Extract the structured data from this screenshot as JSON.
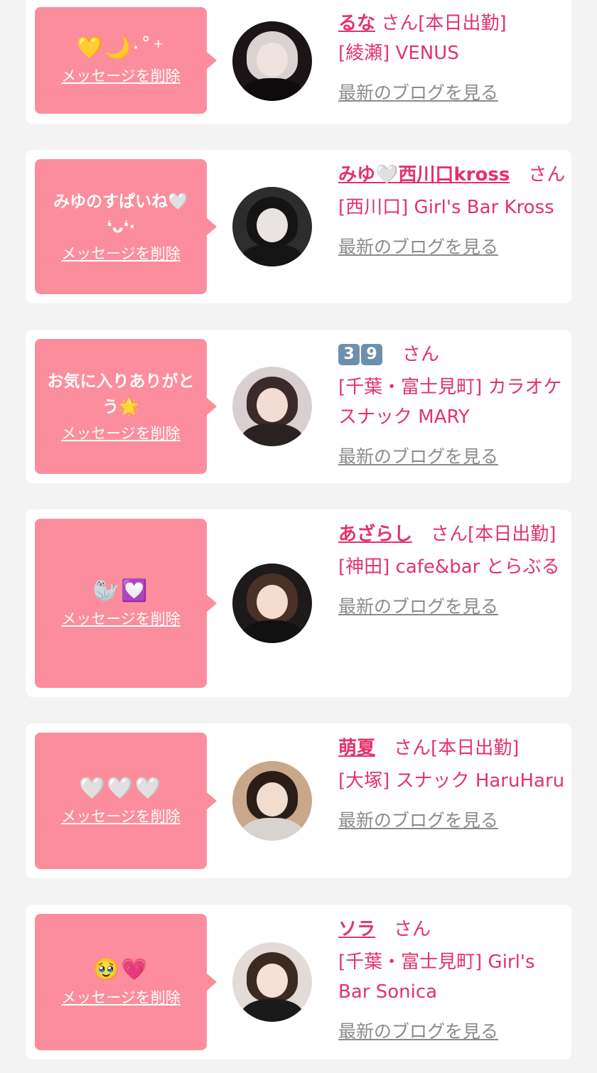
{
  "items": [
    {
      "message": "",
      "message_emoji": "💛🌙·˚⁺",
      "delete_label": "メッセージを削除",
      "name": "るな",
      "san": "さん",
      "status": "[本日出勤]",
      "shop": "[綾瀬] VENUS",
      "blog_label": "最新のブログを見る"
    },
    {
      "message": "みゆのすぱいね🤍 ❛ᴗ❛·",
      "message_emoji": "",
      "delete_label": "メッセージを削除",
      "name": "みゆ🤍西川口kross",
      "san": "さん",
      "status": "",
      "shop": "[西川口] Girl's Bar Kross",
      "blog_label": "最新のブログを見る"
    },
    {
      "message": "お気に入りありがとう🌟",
      "message_emoji": "",
      "delete_label": "メッセージを削除",
      "name_keycaps": [
        "3",
        "9"
      ],
      "san": "さん",
      "status": "",
      "shop": "[千葉・富士見町] カラオケスナック MARY",
      "blog_label": "最新のブログを見る"
    },
    {
      "message": "",
      "message_emoji": "🦭💟",
      "delete_label": "メッセージを削除",
      "name": "あざらし",
      "san": "さん",
      "status": "[本日出勤]",
      "shop": "[神田] cafe&bar とらぶる",
      "blog_label": "最新のブログを見る"
    },
    {
      "message": "",
      "message_emoji": "🤍🤍🤍",
      "delete_label": "メッセージを削除",
      "name": "萌夏",
      "san": "さん",
      "status": "[本日出勤]",
      "shop": "[大塚] スナック HaruHaru",
      "blog_label": "最新のブログを見る"
    },
    {
      "message": "",
      "message_emoji": "🥹💗",
      "delete_label": "メッセージを削除",
      "name": "ソラ",
      "san": "さん",
      "status": "",
      "shop": "[千葉・富士見町] Girl's Bar Sonica",
      "blog_label": "最新のブログを見る"
    }
  ]
}
